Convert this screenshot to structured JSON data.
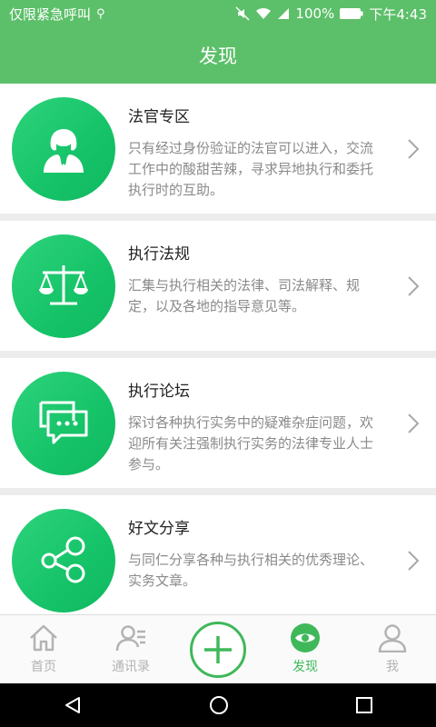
{
  "status_bar": {
    "carrier": "仅限紧急呼叫",
    "battery": "100%",
    "time": "下午4:43"
  },
  "header": {
    "title": "发现"
  },
  "cards": [
    {
      "title": "法官专区",
      "desc": "只有经过身份验证的法官可以进入，交流工作中的酸甜苦辣，寻求异地执行和委托执行时的互助。",
      "icon": "judge-icon"
    },
    {
      "title": "执行法规",
      "desc": "汇集与执行相关的法律、司法解释、规定，以及各地的指导意见等。",
      "icon": "scales-icon"
    },
    {
      "title": "执行论坛",
      "desc": "探讨各种执行实务中的疑难杂症问题，欢迎所有关注强制执行实务的法律专业人士参与。",
      "icon": "chat-icon"
    },
    {
      "title": "好文分享",
      "desc": "与同仁分享各种与执行相关的优秀理论、实务文章。",
      "icon": "share-icon"
    }
  ],
  "tabs": [
    {
      "label": "首页",
      "icon": "home-icon"
    },
    {
      "label": "通讯录",
      "icon": "contacts-icon"
    },
    {
      "label": "",
      "icon": "plus-icon"
    },
    {
      "label": "发现",
      "icon": "eye-icon",
      "active": true
    },
    {
      "label": "我",
      "icon": "user-icon"
    }
  ],
  "colors": {
    "primary": "#5cbf69",
    "accent": "#3fb85a",
    "icon_bg": "#16c368"
  }
}
